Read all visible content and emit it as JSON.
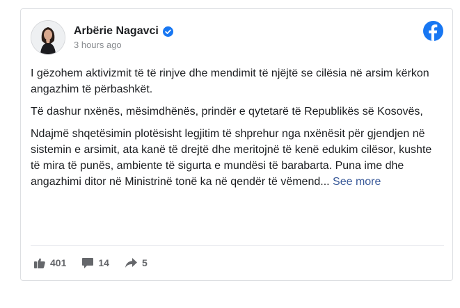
{
  "post": {
    "author": "Arbërie Nagavci",
    "timestamp": "3 hours ago",
    "paragraphs": {
      "p1": "I gëzohem aktivizmit të të rinjve dhe mendimit të njëjtë se cilësia në arsim kërkon angazhim të përbashkët.",
      "p2": "Të dashur nxënës, mësimdhënës, prindër e qytetarë të Republikës së Kosovës,",
      "p3": "Ndajmë shqetësimin plotësisht legjitim të shprehur nga nxënësit për gjendjen në sistemin e arsimit, ata kanë të drejtë dhe meritojnë të kenë edukim cilësor, kushte të mira të punës, ambiente të sigurta e mundësi të barabarta. Puna ime dhe angazhimi ditor në Ministrinë tonë ka në qendër të vëmend..."
    },
    "see_more": "See more"
  },
  "stats": {
    "likes": "401",
    "comments": "14",
    "shares": "5"
  },
  "icons": {
    "verified": "verified-badge-icon",
    "brand": "facebook-logo-icon",
    "like": "thumbs-up-icon",
    "comment": "comment-icon",
    "share": "share-arrow-icon"
  },
  "colors": {
    "brand": "#1877f2",
    "link": "#385898",
    "text": "#1c1e21",
    "muted": "#8a8d91",
    "actions": "#65676b"
  }
}
